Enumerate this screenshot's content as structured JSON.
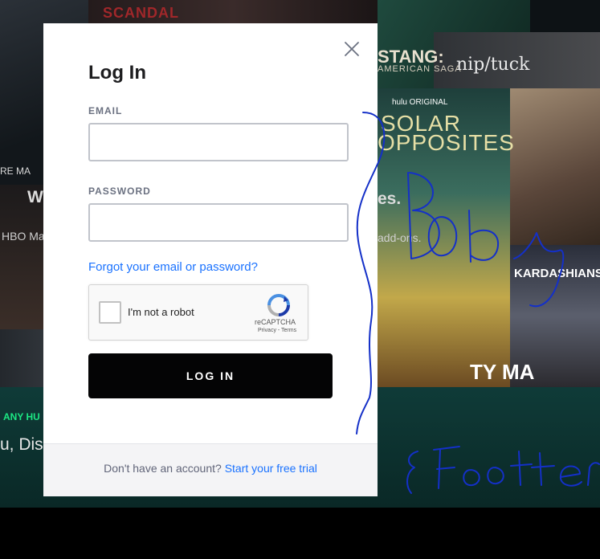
{
  "background": {
    "show_title_1": "SCANDAL",
    "show_title_2": "STANG:",
    "show_title_2_sub": "AMERICAN SAGA",
    "show_title_3": "nip/tuck",
    "hulu_original_badge": "hulu ORIGINAL",
    "show_title_4_line1": "SOLAR",
    "show_title_4_line2": "OPPOSITES",
    "show_title_5": "KARDASHIANS",
    "headline_left": "W",
    "headline_right": "es.",
    "subtext_left": "HBO Ma",
    "subtext_right": "add-ons.",
    "promo_label": "ANY HU",
    "promo_text": "u, Dis",
    "tile_text_small": "RE MA",
    "tile_text_tyma": "TY MA"
  },
  "annotations": {
    "body_label": "Body",
    "footer_label": "Footer",
    "ink_color": "#1430c8"
  },
  "modal": {
    "close_icon": "close-icon",
    "title": "Log In",
    "email_label": "EMAIL",
    "email_value": "",
    "email_placeholder": "",
    "password_label": "PASSWORD",
    "password_value": "",
    "password_placeholder": "",
    "forgot_link": "Forgot your email or password?",
    "captcha": {
      "checkbox_label": "I'm not a robot",
      "brand": "reCAPTCHA",
      "terms": "Privacy - Terms",
      "logo_icon": "recaptcha-logo-icon"
    },
    "login_button": "LOG IN",
    "footer_text": "Don't have an account?",
    "footer_link": "Start your free trial"
  },
  "colors": {
    "brand_green": "#1ce783",
    "link_blue": "#1a72ff",
    "button_black": "#040405"
  }
}
